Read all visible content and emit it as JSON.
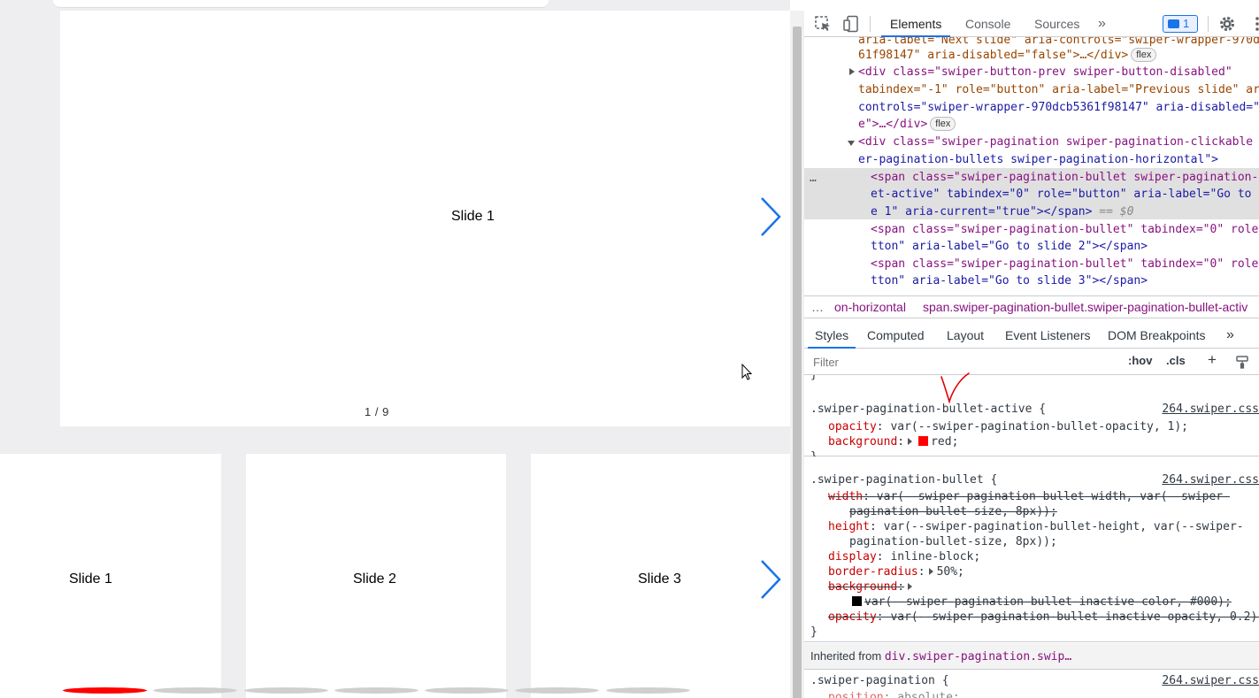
{
  "viewport": {
    "main_slide_label": "Slide 1",
    "fraction_label": "1 / 9",
    "thumb_slides": [
      "Slide 1",
      "Slide 2",
      "Slide 3"
    ],
    "bullets": [
      true,
      false,
      false,
      false,
      false,
      false,
      false
    ],
    "colors": {
      "accent_arrow": "#1a73e8",
      "active_bullet": "#ff0000",
      "inactive_bullet": "#cfcfcf"
    }
  },
  "devtools": {
    "tabs": [
      "Elements",
      "Console",
      "Sources"
    ],
    "active_tab": "Elements",
    "more_tabs": "»",
    "issues_count": "1",
    "dom_lines": {
      "l0": "aria-label=\"Next slide\" aria-controls=\"swiper-wrapper-970d",
      "l1": "61f98147\" aria-disabled=\"false\">…</div>",
      "l2": "<div class=\"swiper-button-prev swiper-button-disabled\"",
      "l3": "tabindex=\"-1\" role=\"button\" aria-label=\"Previous slide\" ar",
      "l4": "controls=\"swiper-wrapper-970dcb5361f98147\" aria-disabled=\"",
      "l5": "e\">…</div>",
      "l6": "<div class=\"swiper-pagination swiper-pagination-clickable",
      "l7": "er-pagination-bullets swiper-pagination-horizontal\">",
      "l8": "<span class=\"swiper-pagination-bullet swiper-pagination-",
      "l9": "et-active\" tabindex=\"0\" role=\"button\" aria-label=\"Go to",
      "l10": "e 1\" aria-current=\"true\"></span>",
      "l10b": " == $0",
      "l11": "<span class=\"swiper-pagination-bullet\" tabindex=\"0\" role",
      "l12": "tton\" aria-label=\"Go to slide 2\"></span>",
      "l13": "<span class=\"swiper-pagination-bullet\" tabindex=\"0\" role",
      "l14": "tton\" aria-label=\"Go to slide 3\"></span>",
      "flex_badge": "flex",
      "ellipsis": "…"
    },
    "breadcrumbs": [
      "…",
      "on-horizontal",
      "span.swiper-pagination-bullet.swiper-pagination-bullet-activ"
    ],
    "sub_tabs": [
      "Styles",
      "Computed",
      "Layout",
      "Event Listeners",
      "DOM Breakpoints"
    ],
    "sub_more": "»",
    "filter_placeholder": "Filter",
    "filter_buttons": [
      ":hov",
      ".cls",
      "+"
    ],
    "styles": {
      "rule1": {
        "selector": ".swiper-pagination-bullet-active {",
        "source": "264.swiper.css",
        "decls": [
          {
            "prop": "opacity",
            "value": "var(--swiper-pagination-bullet-opacity, 1);"
          },
          {
            "prop": "background",
            "value": "red;"
          }
        ]
      },
      "rule2": {
        "selector": ".swiper-pagination-bullet {",
        "source": "264.swiper.css",
        "width_prop": "width",
        "width_val": "var(--swiper-pagination-bullet-width, var(--swiper-",
        "width_cont": "pagination-bullet-size, 8px));",
        "height_prop": "height",
        "height_val": "var(--swiper-pagination-bullet-height, var(--swiper-",
        "height_cont": "pagination-bullet-size, 8px));",
        "display_prop": "display",
        "display_val": "inline-block;",
        "radius_prop": "border-radius",
        "radius_val": "50%;",
        "bg_prop": "background",
        "bg_cont": "var(--swiper-pagination-bullet-inactive-color, #000);",
        "opacity_prop": "opacity",
        "opacity_val": "var(--swiper-pagination-bullet-inactive-opacity, 0.2);"
      },
      "brace_close": "}",
      "brace_open_top": "}",
      "inherited_label": "Inherited from",
      "inherited_link": "div.swiper-pagination.swip…",
      "rule3": {
        "selector": ".swiper-pagination {",
        "source": "264.swiper.css",
        "prop": "position",
        "value": "absolute;"
      }
    }
  }
}
